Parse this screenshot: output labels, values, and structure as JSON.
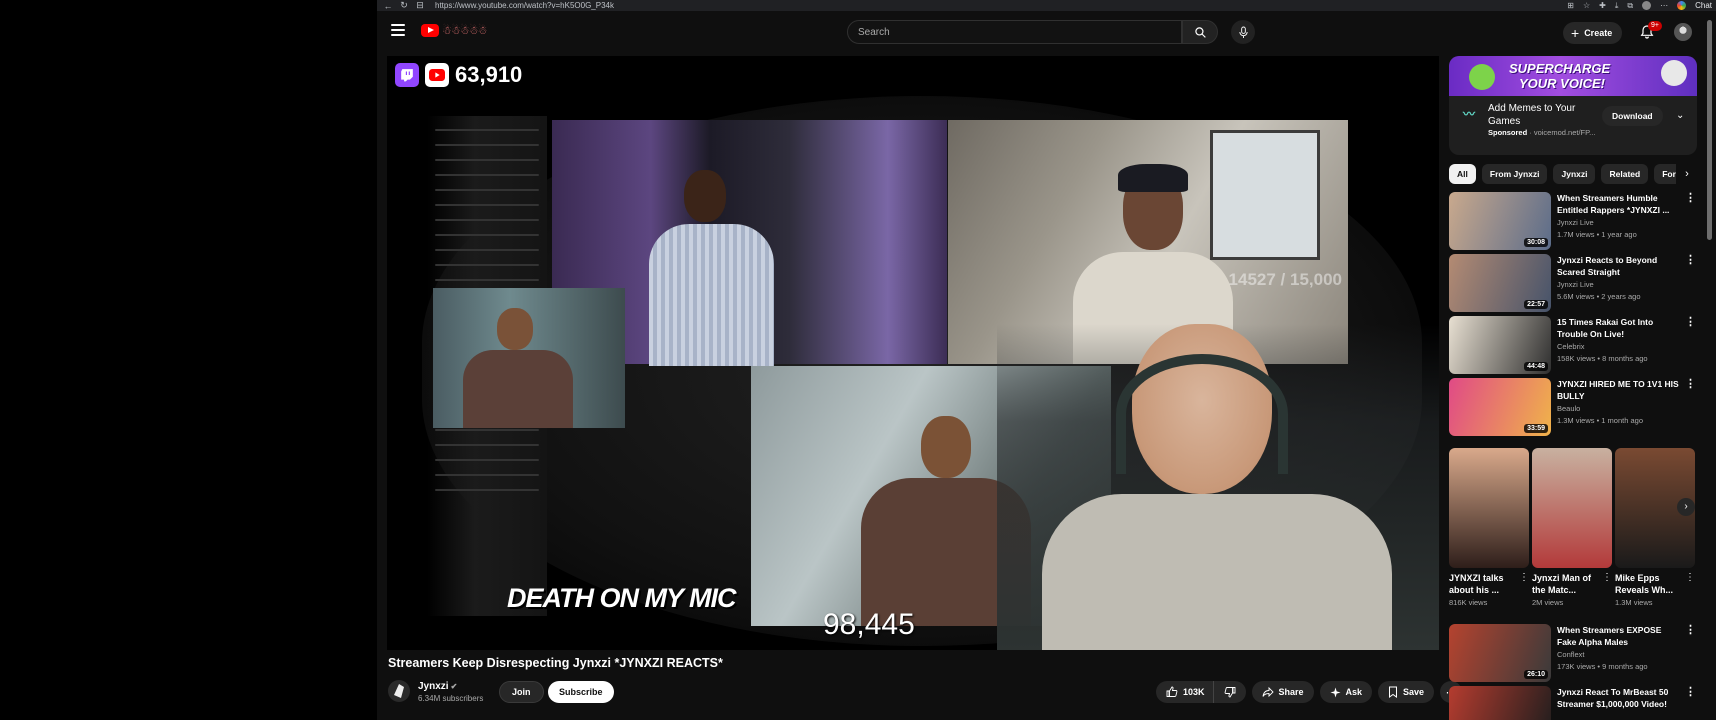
{
  "browser": {
    "url": "https://www.youtube.com/watch?v=hK5O0G_P34k",
    "chat_label": "Chat"
  },
  "header": {
    "search_placeholder": "Search",
    "create_label": "Create",
    "notifications_badge": "9+"
  },
  "player": {
    "viewer_count": "63,910",
    "overlay_caption": "DEATH ON MY MIC",
    "overlay_views": "98,445",
    "overlay_counter": "14527 / 15,000"
  },
  "video": {
    "title": "Streamers Keep Disrespecting Jynxzi *JYNXZI REACTS*",
    "channel_name": "Jynxzi",
    "subscribers": "6.34M subscribers",
    "join_label": "Join",
    "subscribe_label": "Subscribe",
    "like_count": "103K",
    "share_label": "Share",
    "ask_label": "Ask",
    "save_label": "Save"
  },
  "ad": {
    "banner_line1": "SUPERCHARGE",
    "banner_line2": "YOUR VOICE!",
    "title": "Add Memes to Your Games",
    "sponsored_label": "Sponsored",
    "domain": "voicemod.net/FP...",
    "download_label": "Download"
  },
  "chips": [
    "All",
    "From Jynxzi",
    "Jynxzi",
    "Related",
    "For"
  ],
  "recommendations": [
    {
      "title": "When Streamers Humble Entitled Rappers *JYNXZI ...",
      "channel": "Jynxzi Live",
      "meta": "1.7M views • 1 year ago",
      "duration": "30:08",
      "color1": "#c9a98d",
      "color2": "#5b6c8a"
    },
    {
      "title": "Jynxzi Reacts to Beyond Scared Straight",
      "channel": "Jynxzi Live",
      "meta": "5.6M views • 2 years ago",
      "duration": "22:57",
      "color1": "#b48b73",
      "color2": "#46536a"
    },
    {
      "title": "15 Times Rakai Got Into Trouble On Live!",
      "channel": "Celebrix",
      "meta": "158K views • 8 months ago",
      "duration": "44:48",
      "color1": "#e8e0d2",
      "color2": "#2f2f2f"
    },
    {
      "title": "JYNXZI HIRED ME TO 1V1 HIS BULLY",
      "channel": "Beaulo",
      "meta": "1.3M views • 1 month ago",
      "duration": "33:59",
      "color1": "#e04a86",
      "color2": "#f0b34a"
    },
    {
      "title": "When Streamers EXPOSE Fake Alpha Males",
      "channel": "Conflext",
      "meta": "173K views • 9 months ago",
      "duration": "26:10",
      "color1": "#b5432f",
      "color2": "#3a3a3a"
    },
    {
      "title": "Jynxzi React To MrBeast 50 Streamer $1,000,000 Video!",
      "channel": "",
      "meta": "",
      "duration": "",
      "color1": "#b53c2f",
      "color2": "#1d1d1d"
    }
  ],
  "shorts": [
    {
      "title": "JYNXZI talks about his ...",
      "views": "816K views",
      "color1": "#d9a98b",
      "color2": "#2e1e1a"
    },
    {
      "title": "Jynxzi Man of the Matc...",
      "views": "2M views",
      "color1": "#c8b1a0",
      "color2": "#b33a3a"
    },
    {
      "title": "Mike Epps Reveals Wh...",
      "views": "1.3M views",
      "color1": "#7a4a32",
      "color2": "#1a1a1a"
    }
  ]
}
